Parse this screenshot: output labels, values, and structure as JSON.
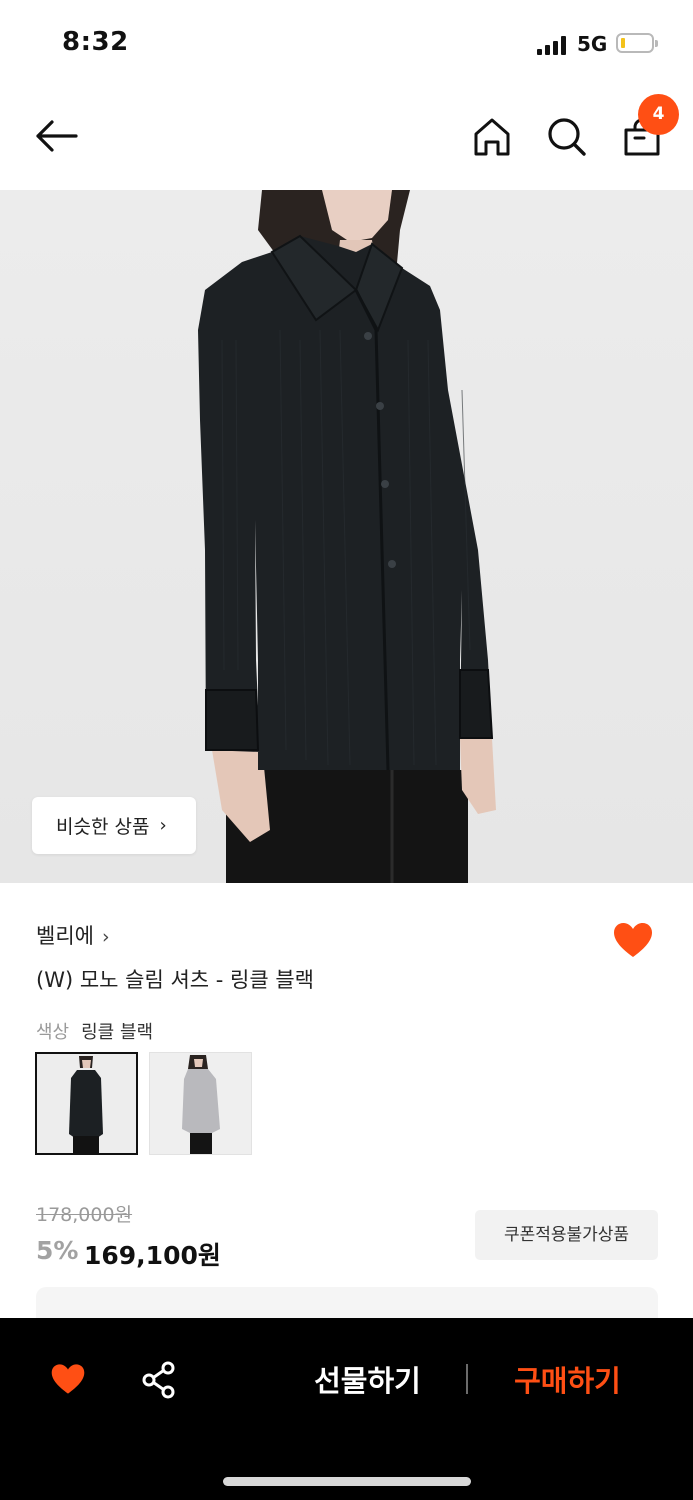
{
  "status": {
    "time": "8:32",
    "network": "5G",
    "battery_color": "#f3c21b"
  },
  "nav": {
    "cart_count": "4"
  },
  "hero": {
    "similar_label": "비슷한 상품",
    "similar_chevron": "›"
  },
  "product": {
    "brand": "벨리에",
    "brand_chevron": "›",
    "title": "(W) 모노 슬림 셔츠 - 링클 블랙",
    "color_label": "색상",
    "color_value": "링클 블랙",
    "original_price": "178,000원",
    "discount": "5%",
    "price": "169,100원",
    "coupon_label": "쿠폰적용불가상품"
  },
  "bottom_bar": {
    "gift_label": "선물하기",
    "buy_label": "구매하기"
  },
  "colors": {
    "accent": "#ff4f14",
    "bar": "#000000"
  }
}
